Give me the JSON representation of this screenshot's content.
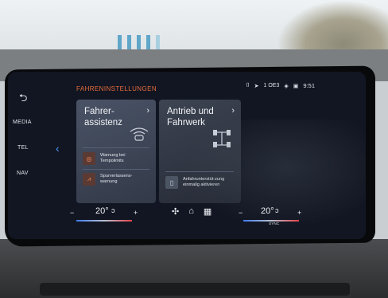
{
  "screen": {
    "title": "FAHRENINSTELLUNGEN",
    "status": {
      "icons": [
        "phone-icon",
        "location-icon",
        "wifi-icon",
        "profile-icon"
      ],
      "network": "1 OE3",
      "time": "9:51"
    }
  },
  "rail": {
    "back_icon": "⮌",
    "items": [
      "MEDIA",
      "TEL",
      "NAV"
    ]
  },
  "nav": {
    "left_chevron": "‹"
  },
  "cards": [
    {
      "title": "Fahrer-\nassistenz",
      "chevron": "›",
      "subitems": [
        {
          "label": "Warnung bei Tempolimits",
          "icon": "speed-limit-icon"
        },
        {
          "label": "Spurverlassens-warnung",
          "icon": "lane-warning-icon"
        }
      ]
    },
    {
      "title": "Antrieb und\nFahrwerk",
      "chevron": "›",
      "subitems": [
        {
          "label": "Anfahrunterstüt-zung einmalig aktivieren",
          "icon": "hill-start-icon"
        }
      ]
    }
  ],
  "climate": {
    "left_temp": "20°",
    "right_temp": "20°",
    "minus": "−",
    "plus": "+",
    "sync": "SYNC"
  },
  "colors": {
    "accent": "#e76b3d",
    "highlight": "#4b9dff",
    "heat": "#e5434a"
  }
}
